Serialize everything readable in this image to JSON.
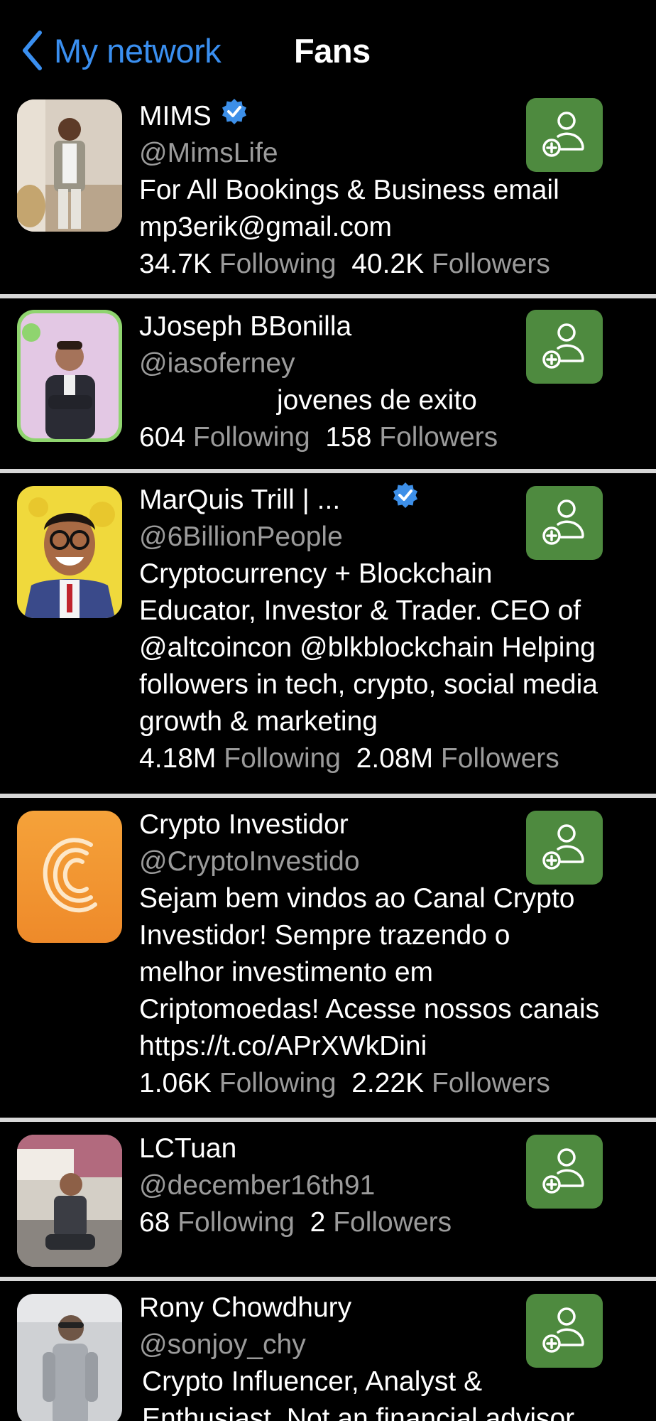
{
  "nav": {
    "back_label": "My network",
    "title": "Fans"
  },
  "colors": {
    "background": "#000000",
    "accent_blue": "#3a8ff0",
    "follow_button": "#4e8a3f",
    "muted_text": "#9b9b9b",
    "divider": "#d7d7d7",
    "verified_badge": "#3d8fe8"
  },
  "labels": {
    "following": "Following",
    "followers": "Followers"
  },
  "users": [
    {
      "name": "MIMS",
      "verified": true,
      "handle": "@MimsLife",
      "bio": "For All Bookings & Business email mp3erik@gmail.com",
      "following": "34.7K",
      "followers": "40.2K",
      "avatar": "photo-man-standing-icon"
    },
    {
      "name": "JJoseph BBonilla",
      "verified": false,
      "handle": "@iasoferney",
      "bio": "jovenes de exito",
      "following": "604",
      "followers": "158",
      "avatar": "photo-man-arms-crossed-icon"
    },
    {
      "name": "MarQuis Trill | ...",
      "verified": true,
      "handle": "@6BillionPeople",
      "bio": "Cryptocurrency + Blockchain Educator, Investor & Trader. CEO of @altcoincon @blkblockchain Helping followers in tech, crypto, social media growth & marketing",
      "following": "4.18M",
      "followers": "2.08M",
      "avatar": "cartoon-man-glasses-icon"
    },
    {
      "name": "Crypto Investidor",
      "verified": false,
      "handle": "@CryptoInvestido",
      "bio": "Sejam bem vindos ao Canal Crypto Investidor! Sempre trazendo o melhor investimento em Criptomoedas! Acesse nossos canais https://t.co/APrXWkDini",
      "following": "1.06K",
      "followers": "2.22K",
      "avatar": "crypto-c-logo-icon"
    },
    {
      "name": "LCTuan",
      "verified": false,
      "handle": "@december16th91",
      "bio": "",
      "following": "68",
      "followers": "2",
      "avatar": "photo-man-sitting-icon"
    },
    {
      "name": "Rony Chowdhury",
      "verified": false,
      "handle": "@sonjoy_chy",
      "bio": "Crypto Influencer, Analyst & Enthusiast. Not an financial advisor",
      "following": "",
      "followers": "",
      "avatar": "photo-man-standing-light-icon"
    }
  ]
}
